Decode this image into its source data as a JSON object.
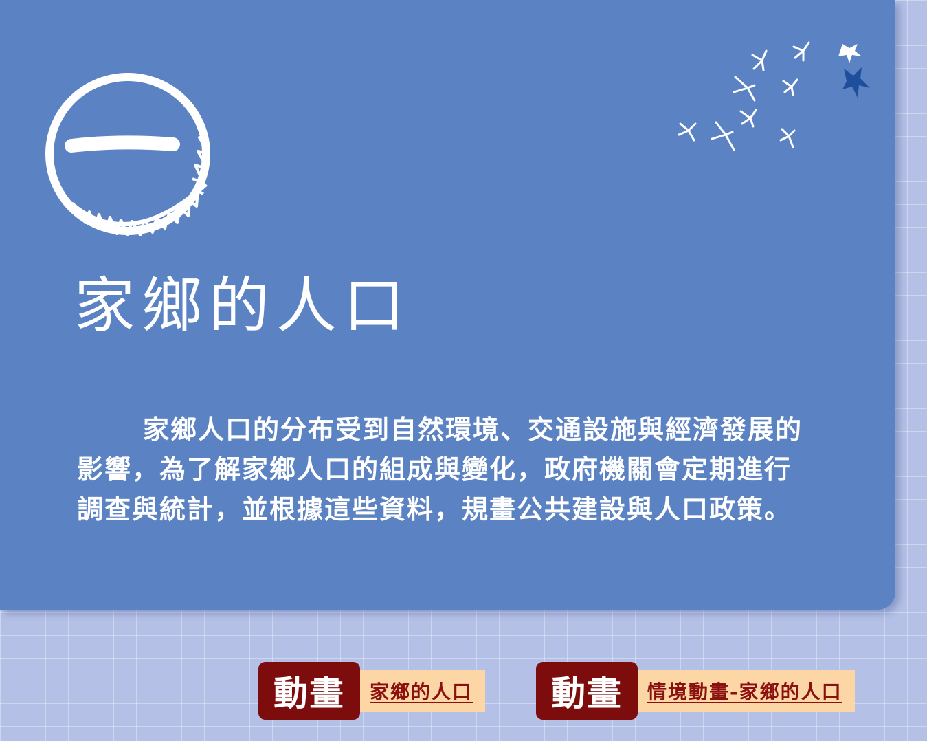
{
  "section": {
    "numeral": "一",
    "title": "家鄉的人口",
    "paragraph": "家鄉人口的分布受到自然環境、交通設施與經濟發展的影響，為了解家鄉人口的組成與變化，政府機關會定期進行調查與統計，並根據這些資料，規畫公共建設與人口政策。"
  },
  "links": [
    {
      "badge": "動畫",
      "label": "家鄉的人口"
    },
    {
      "badge": "動畫",
      "label": "情境動畫-家鄉的人口"
    }
  ],
  "colors": {
    "card": "#5b82c3",
    "background": "#b4c0e6",
    "badge": "#7d0d0d",
    "link_bg": "#fcd6a4",
    "link_text": "#8b1010",
    "accent_bird": "#1f4e9c"
  },
  "icons": {
    "numeral_badge": "circled-numeral-one-icon",
    "decoration": "flying-birds-icon"
  }
}
